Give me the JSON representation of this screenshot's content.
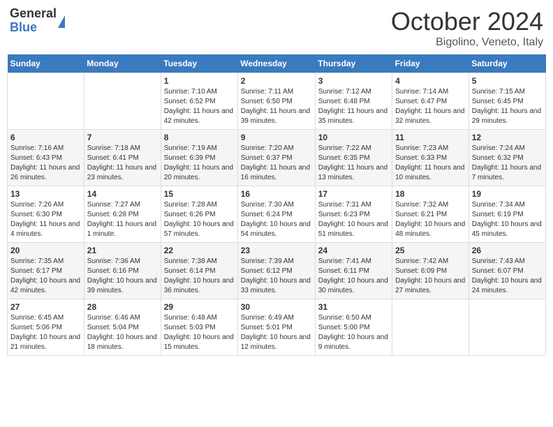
{
  "header": {
    "logo_general": "General",
    "logo_blue": "Blue",
    "month": "October 2024",
    "location": "Bigolino, Veneto, Italy"
  },
  "days_of_week": [
    "Sunday",
    "Monday",
    "Tuesday",
    "Wednesday",
    "Thursday",
    "Friday",
    "Saturday"
  ],
  "weeks": [
    [
      {
        "num": "",
        "info": ""
      },
      {
        "num": "",
        "info": ""
      },
      {
        "num": "1",
        "info": "Sunrise: 7:10 AM\nSunset: 6:52 PM\nDaylight: 11 hours and 42 minutes."
      },
      {
        "num": "2",
        "info": "Sunrise: 7:11 AM\nSunset: 6:50 PM\nDaylight: 11 hours and 39 minutes."
      },
      {
        "num": "3",
        "info": "Sunrise: 7:12 AM\nSunset: 6:48 PM\nDaylight: 11 hours and 35 minutes."
      },
      {
        "num": "4",
        "info": "Sunrise: 7:14 AM\nSunset: 6:47 PM\nDaylight: 11 hours and 32 minutes."
      },
      {
        "num": "5",
        "info": "Sunrise: 7:15 AM\nSunset: 6:45 PM\nDaylight: 11 hours and 29 minutes."
      }
    ],
    [
      {
        "num": "6",
        "info": "Sunrise: 7:16 AM\nSunset: 6:43 PM\nDaylight: 11 hours and 26 minutes."
      },
      {
        "num": "7",
        "info": "Sunrise: 7:18 AM\nSunset: 6:41 PM\nDaylight: 11 hours and 23 minutes."
      },
      {
        "num": "8",
        "info": "Sunrise: 7:19 AM\nSunset: 6:39 PM\nDaylight: 11 hours and 20 minutes."
      },
      {
        "num": "9",
        "info": "Sunrise: 7:20 AM\nSunset: 6:37 PM\nDaylight: 11 hours and 16 minutes."
      },
      {
        "num": "10",
        "info": "Sunrise: 7:22 AM\nSunset: 6:35 PM\nDaylight: 11 hours and 13 minutes."
      },
      {
        "num": "11",
        "info": "Sunrise: 7:23 AM\nSunset: 6:33 PM\nDaylight: 11 hours and 10 minutes."
      },
      {
        "num": "12",
        "info": "Sunrise: 7:24 AM\nSunset: 6:32 PM\nDaylight: 11 hours and 7 minutes."
      }
    ],
    [
      {
        "num": "13",
        "info": "Sunrise: 7:26 AM\nSunset: 6:30 PM\nDaylight: 11 hours and 4 minutes."
      },
      {
        "num": "14",
        "info": "Sunrise: 7:27 AM\nSunset: 6:28 PM\nDaylight: 11 hours and 1 minute."
      },
      {
        "num": "15",
        "info": "Sunrise: 7:28 AM\nSunset: 6:26 PM\nDaylight: 10 hours and 57 minutes."
      },
      {
        "num": "16",
        "info": "Sunrise: 7:30 AM\nSunset: 6:24 PM\nDaylight: 10 hours and 54 minutes."
      },
      {
        "num": "17",
        "info": "Sunrise: 7:31 AM\nSunset: 6:23 PM\nDaylight: 10 hours and 51 minutes."
      },
      {
        "num": "18",
        "info": "Sunrise: 7:32 AM\nSunset: 6:21 PM\nDaylight: 10 hours and 48 minutes."
      },
      {
        "num": "19",
        "info": "Sunrise: 7:34 AM\nSunset: 6:19 PM\nDaylight: 10 hours and 45 minutes."
      }
    ],
    [
      {
        "num": "20",
        "info": "Sunrise: 7:35 AM\nSunset: 6:17 PM\nDaylight: 10 hours and 42 minutes."
      },
      {
        "num": "21",
        "info": "Sunrise: 7:36 AM\nSunset: 6:16 PM\nDaylight: 10 hours and 39 minutes."
      },
      {
        "num": "22",
        "info": "Sunrise: 7:38 AM\nSunset: 6:14 PM\nDaylight: 10 hours and 36 minutes."
      },
      {
        "num": "23",
        "info": "Sunrise: 7:39 AM\nSunset: 6:12 PM\nDaylight: 10 hours and 33 minutes."
      },
      {
        "num": "24",
        "info": "Sunrise: 7:41 AM\nSunset: 6:11 PM\nDaylight: 10 hours and 30 minutes."
      },
      {
        "num": "25",
        "info": "Sunrise: 7:42 AM\nSunset: 6:09 PM\nDaylight: 10 hours and 27 minutes."
      },
      {
        "num": "26",
        "info": "Sunrise: 7:43 AM\nSunset: 6:07 PM\nDaylight: 10 hours and 24 minutes."
      }
    ],
    [
      {
        "num": "27",
        "info": "Sunrise: 6:45 AM\nSunset: 5:06 PM\nDaylight: 10 hours and 21 minutes."
      },
      {
        "num": "28",
        "info": "Sunrise: 6:46 AM\nSunset: 5:04 PM\nDaylight: 10 hours and 18 minutes."
      },
      {
        "num": "29",
        "info": "Sunrise: 6:48 AM\nSunset: 5:03 PM\nDaylight: 10 hours and 15 minutes."
      },
      {
        "num": "30",
        "info": "Sunrise: 6:49 AM\nSunset: 5:01 PM\nDaylight: 10 hours and 12 minutes."
      },
      {
        "num": "31",
        "info": "Sunrise: 6:50 AM\nSunset: 5:00 PM\nDaylight: 10 hours and 9 minutes."
      },
      {
        "num": "",
        "info": ""
      },
      {
        "num": "",
        "info": ""
      }
    ]
  ]
}
